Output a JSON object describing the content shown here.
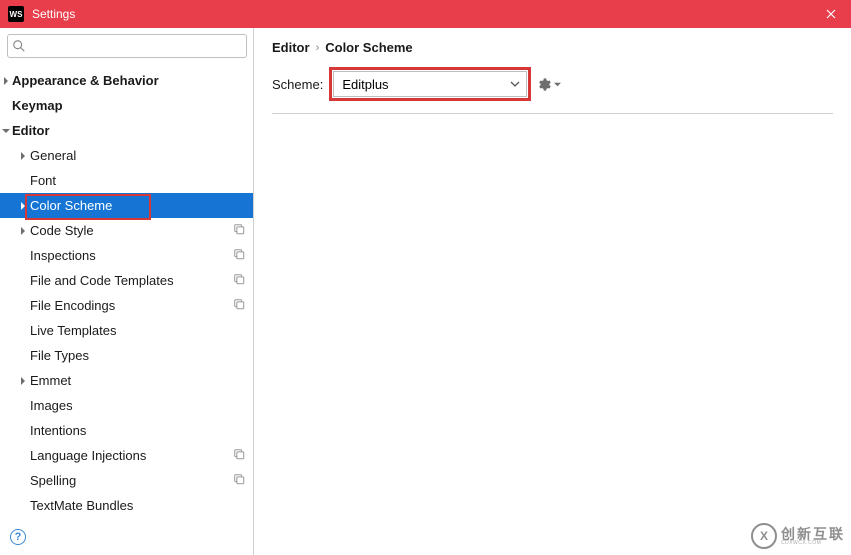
{
  "window": {
    "app_badge": "WS",
    "title": "Settings"
  },
  "breadcrumb": {
    "parent": "Editor",
    "current": "Color Scheme"
  },
  "scheme": {
    "label": "Scheme:",
    "value": "Editplus"
  },
  "tree": [
    {
      "label": "Appearance & Behavior",
      "level": 0,
      "expandable": true,
      "expanded": false,
      "selected": false,
      "copy": false
    },
    {
      "label": "Keymap",
      "level": 0,
      "expandable": false,
      "expanded": false,
      "selected": false,
      "copy": false
    },
    {
      "label": "Editor",
      "level": 0,
      "expandable": true,
      "expanded": true,
      "selected": false,
      "copy": false
    },
    {
      "label": "General",
      "level": 1,
      "expandable": true,
      "expanded": false,
      "selected": false,
      "copy": false
    },
    {
      "label": "Font",
      "level": 1,
      "expandable": false,
      "expanded": false,
      "selected": false,
      "copy": false
    },
    {
      "label": "Color Scheme",
      "level": 1,
      "expandable": true,
      "expanded": false,
      "selected": true,
      "copy": false,
      "highlighted": true
    },
    {
      "label": "Code Style",
      "level": 1,
      "expandable": true,
      "expanded": false,
      "selected": false,
      "copy": true
    },
    {
      "label": "Inspections",
      "level": 1,
      "expandable": false,
      "expanded": false,
      "selected": false,
      "copy": true
    },
    {
      "label": "File and Code Templates",
      "level": 1,
      "expandable": false,
      "expanded": false,
      "selected": false,
      "copy": true
    },
    {
      "label": "File Encodings",
      "level": 1,
      "expandable": false,
      "expanded": false,
      "selected": false,
      "copy": true
    },
    {
      "label": "Live Templates",
      "level": 1,
      "expandable": false,
      "expanded": false,
      "selected": false,
      "copy": false
    },
    {
      "label": "File Types",
      "level": 1,
      "expandable": false,
      "expanded": false,
      "selected": false,
      "copy": false
    },
    {
      "label": "Emmet",
      "level": 1,
      "expandable": true,
      "expanded": false,
      "selected": false,
      "copy": false
    },
    {
      "label": "Images",
      "level": 1,
      "expandable": false,
      "expanded": false,
      "selected": false,
      "copy": false
    },
    {
      "label": "Intentions",
      "level": 1,
      "expandable": false,
      "expanded": false,
      "selected": false,
      "copy": false
    },
    {
      "label": "Language Injections",
      "level": 1,
      "expandable": false,
      "expanded": false,
      "selected": false,
      "copy": true
    },
    {
      "label": "Spelling",
      "level": 1,
      "expandable": false,
      "expanded": false,
      "selected": false,
      "copy": true
    },
    {
      "label": "TextMate Bundles",
      "level": 1,
      "expandable": false,
      "expanded": false,
      "selected": false,
      "copy": false
    }
  ],
  "watermark": {
    "logo": "X",
    "main": "创新互联",
    "sub": "CDXWCX.COM"
  }
}
